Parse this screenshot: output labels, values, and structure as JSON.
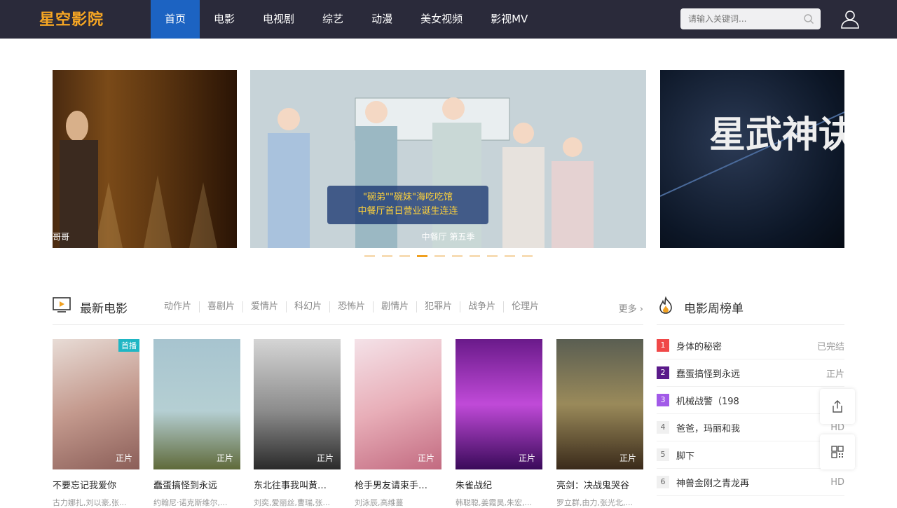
{
  "header": {
    "logo": "星空影院",
    "nav": [
      {
        "label": "首页",
        "active": true
      },
      {
        "label": "电影"
      },
      {
        "label": "电视剧"
      },
      {
        "label": "综艺"
      },
      {
        "label": "动漫"
      },
      {
        "label": "美女视频"
      },
      {
        "label": "影视MV"
      }
    ],
    "search_placeholder": "请输入关键词..."
  },
  "carousel": {
    "left_caption": "哥哥",
    "center_caption": "中餐厅 第五季",
    "center_headline": "\"碗弟\"\"碗妹\"海吃吃馆 中餐厅首日营业诞生连连",
    "right_title": "星武神诀",
    "dot_count": 10,
    "active_dot": 3
  },
  "latest": {
    "title": "最新电影",
    "categories": [
      "动作片",
      "喜剧片",
      "爱情片",
      "科幻片",
      "恐怖片",
      "剧情片",
      "犯罪片",
      "战争片",
      "伦理片"
    ],
    "more": "更多",
    "movies": [
      {
        "title": "不要忘记我爱你",
        "actors": "古力娜扎,刘以豪,张...",
        "badge": "正片",
        "top_badge": "首播"
      },
      {
        "title": "蠢蛋搞怪到永远",
        "actors": "约翰尼·诺克斯维尔,...",
        "badge": "正片"
      },
      {
        "title": "东北往事我叫黄…",
        "actors": "刘奕,爱丽丝,曹瑞,张...",
        "badge": "正片"
      },
      {
        "title": "枪手男友请束手…",
        "actors": "刘泳辰,高维蔓",
        "badge": "正片"
      },
      {
        "title": "朱雀战纪",
        "actors": "韩聪聪,姜霞昊,朱宏,...",
        "badge": "正片"
      },
      {
        "title": "亮剑：决战鬼哭谷",
        "actors": "罗立群,由力,张光北,...",
        "badge": "正片"
      }
    ]
  },
  "ranking": {
    "title": "电影周榜单",
    "items": [
      {
        "num": "1",
        "name": "身体的秘密",
        "status": "已完结"
      },
      {
        "num": "2",
        "name": "蠢蛋搞怪到永远",
        "status": "正片"
      },
      {
        "num": "3",
        "name": "机械战警（198",
        "status": ""
      },
      {
        "num": "4",
        "name": "爸爸，玛丽和我",
        "status": "HD"
      },
      {
        "num": "5",
        "name": "脚下",
        "status": ""
      },
      {
        "num": "6",
        "name": "神兽金刚之青龙再",
        "status": "HD"
      }
    ]
  },
  "colors": {
    "nav_bg": "#2a2a3a",
    "active": "#1c63c2",
    "logo": "#f6a623",
    "rank1": "#f04848",
    "rank2": "#5a1a8a",
    "rank3": "#a25ae8"
  }
}
